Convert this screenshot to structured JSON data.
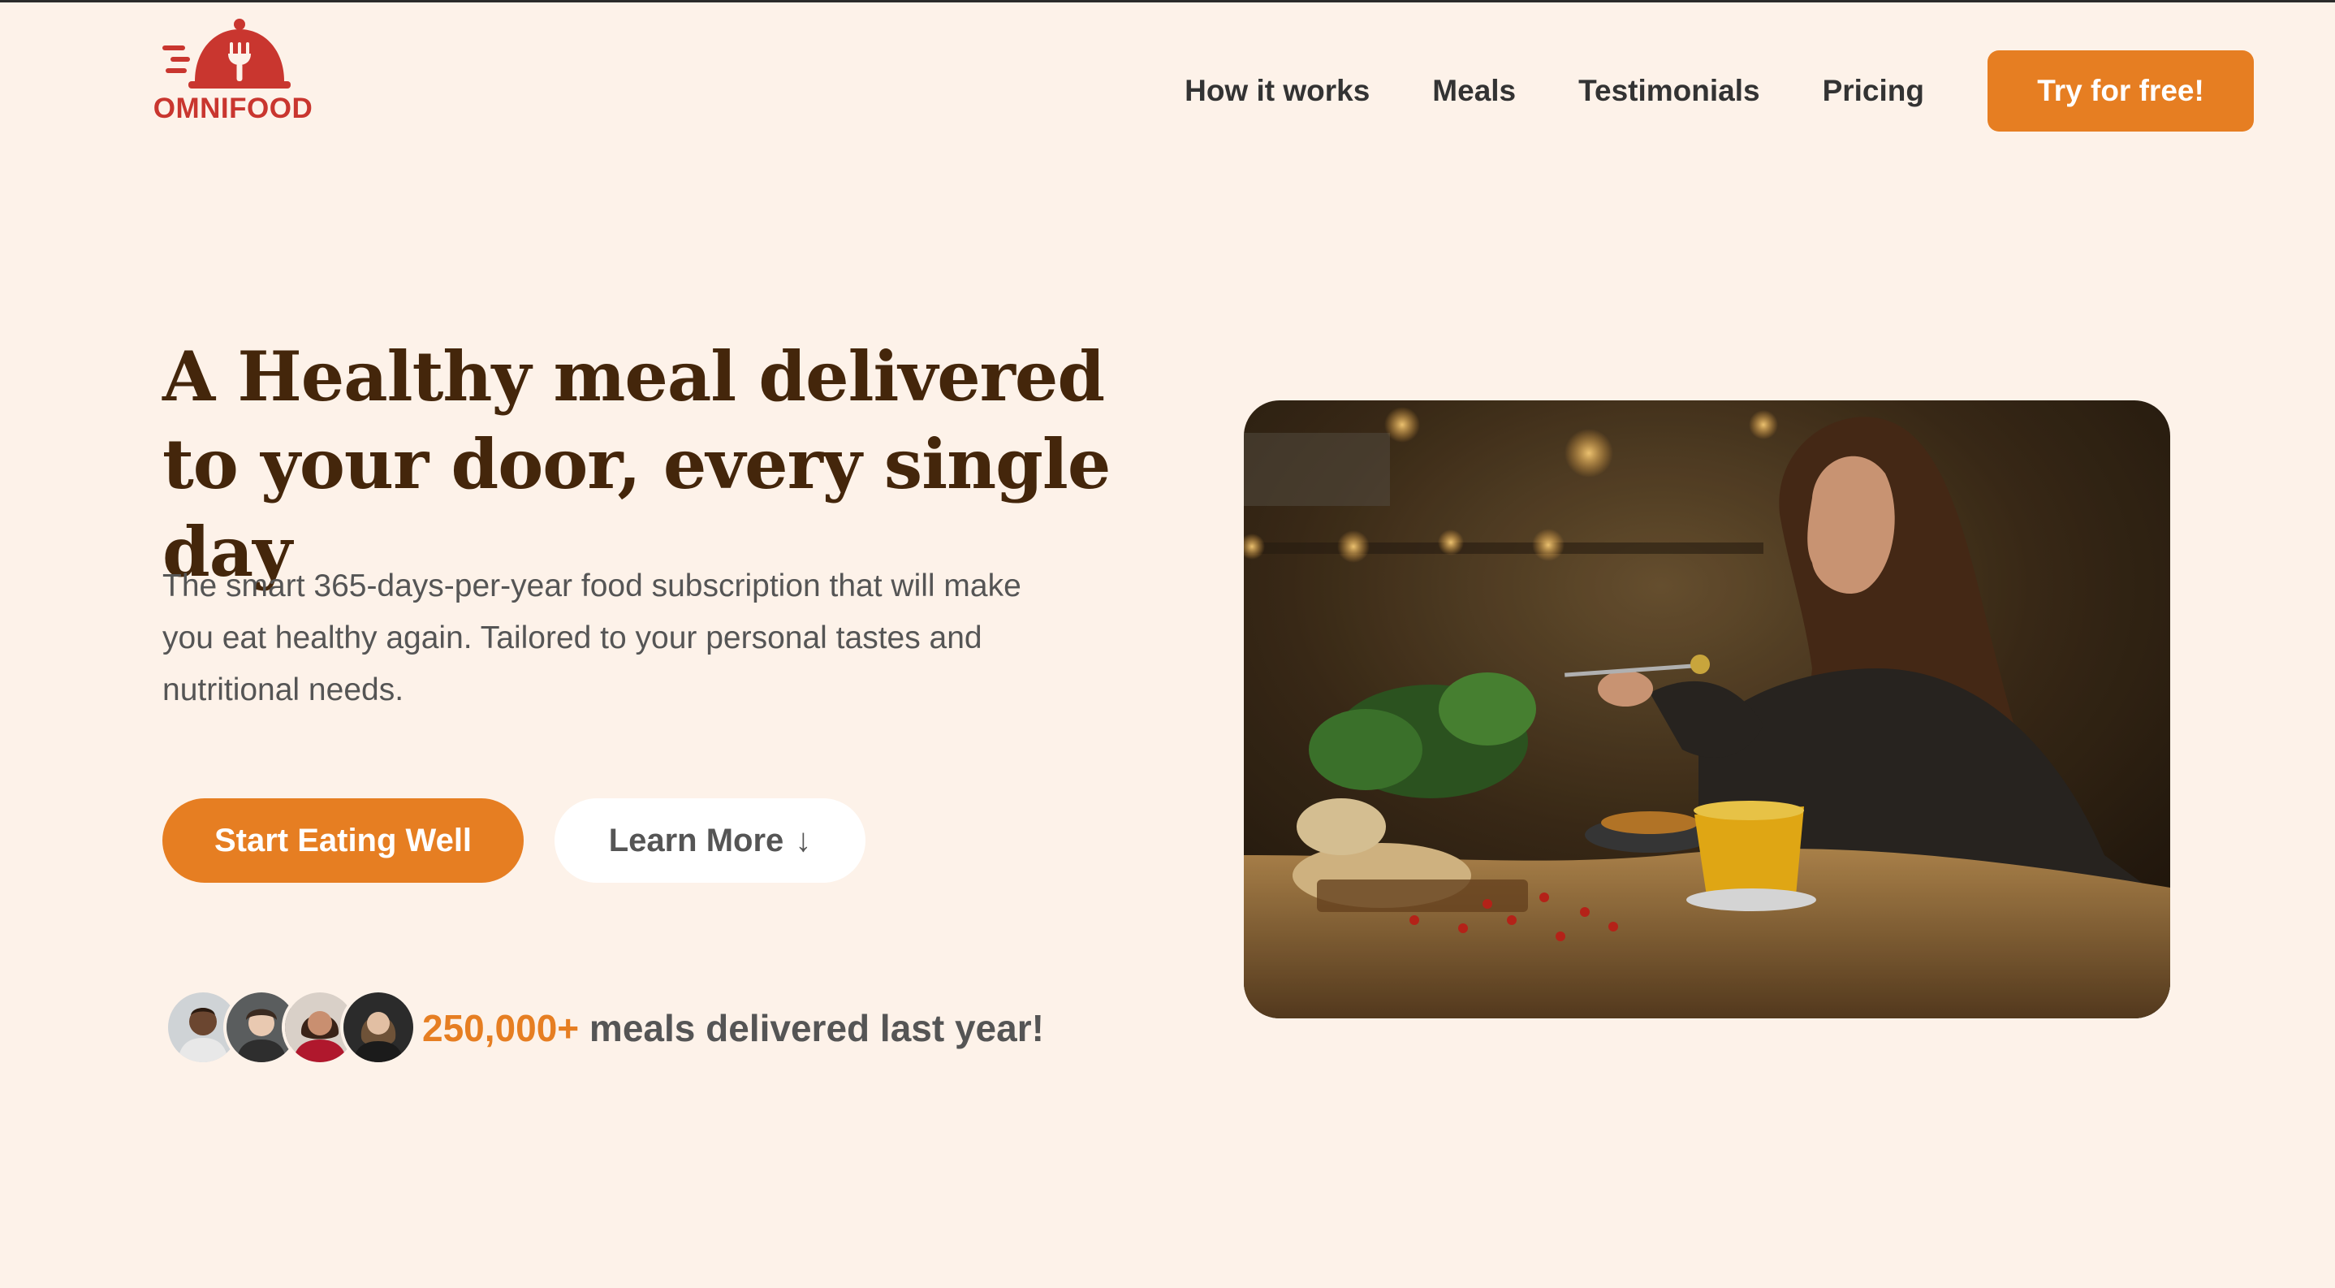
{
  "header": {
    "logo_text": "OMNIFOOD",
    "nav": [
      {
        "label": "How it works"
      },
      {
        "label": "Meals"
      },
      {
        "label": "Testimonials"
      },
      {
        "label": "Pricing"
      }
    ],
    "cta_label": "Try for free!"
  },
  "hero": {
    "title": "A Healthy meal delivered to your door, every single day",
    "description": "The smart 365-days-per-year food subscription that will make you eat healthy again. Tailored to your personal tastes and nutritional needs.",
    "primary_button": "Start Eating Well",
    "secondary_button": "Learn More",
    "secondary_button_arrow": "↓",
    "delivered_count": "250,000+",
    "delivered_text": " meals delivered last year!"
  },
  "colors": {
    "background": "#fdf2e9",
    "accent": "#e67e22",
    "logo": "#c9362f",
    "title": "#44260b",
    "text": "#555555"
  },
  "icons": [
    "omnifood-logo-icon",
    "down-arrow-icon"
  ]
}
